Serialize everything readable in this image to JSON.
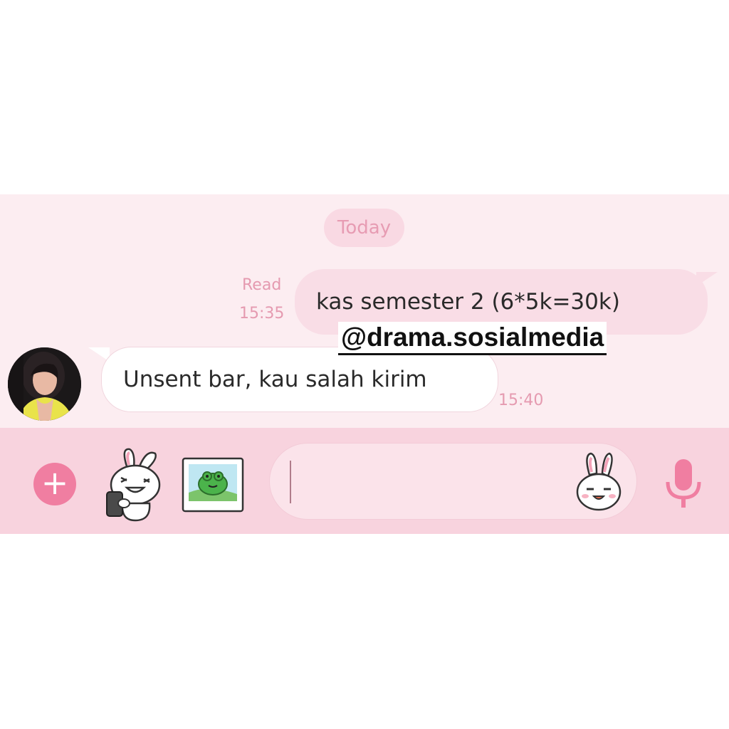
{
  "chat": {
    "date_label": "Today",
    "messages": [
      {
        "direction": "outgoing",
        "status": "Read",
        "time": "15:35",
        "text": "kas semester 2 (6*5k=30k)"
      },
      {
        "direction": "incoming",
        "time": "15:40",
        "text": "Unsent bar, kau salah kirim"
      }
    ]
  },
  "watermark": "@drama.sosialmedia",
  "composer": {
    "plus_icon": "plus-icon",
    "sticker_icon": "bunny-sticker-icon",
    "gallery_icon": "photo-gallery-icon",
    "emoji_icon": "bunny-emoji-icon",
    "mic_icon": "microphone-icon",
    "input_value": ""
  },
  "colors": {
    "accent": "#f07ea1",
    "chat_background": "#fcedf1",
    "outgoing_bubble": "#f9dde6",
    "incoming_bubble": "#ffffff",
    "composer_background": "#f8d3de",
    "meta_text": "#e59ab0"
  }
}
